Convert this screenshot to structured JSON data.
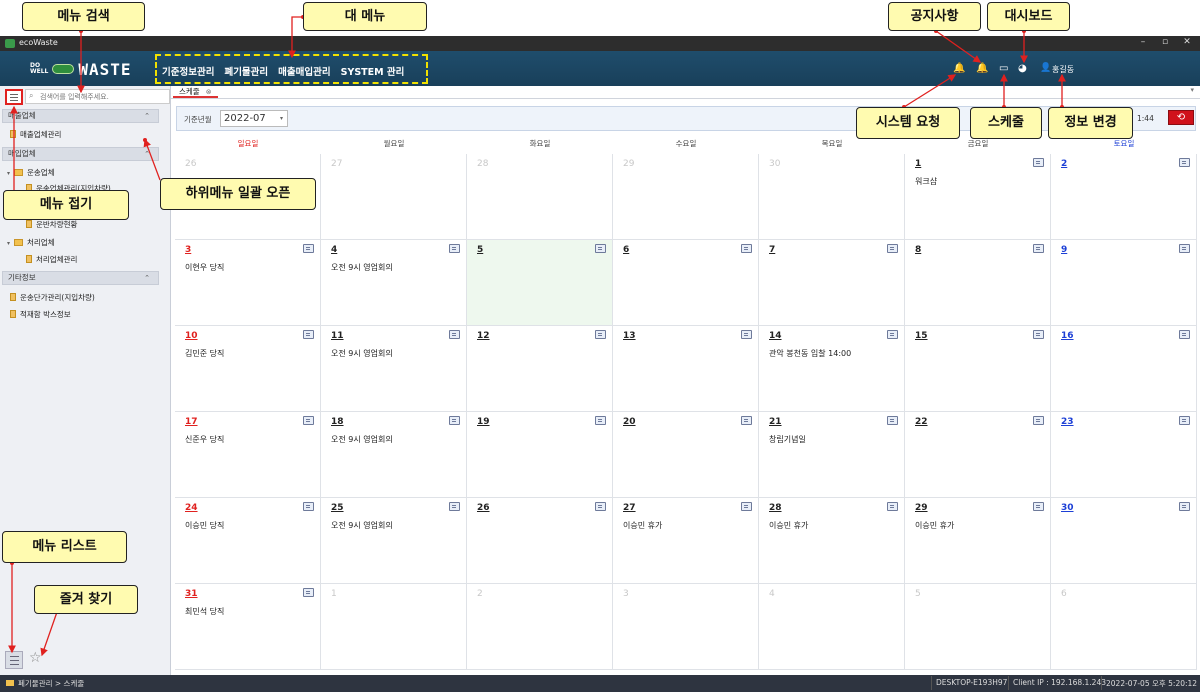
{
  "window": {
    "title": "ecoWaste",
    "buttons": [
      "–",
      "▫",
      "✕"
    ]
  },
  "header": {
    "logo_small": "DO\nWELL",
    "logo_text": "WASTE",
    "main_menu": [
      "기준정보관리",
      "폐기물관리",
      "매출매입관리",
      "SYSTEM 관리"
    ],
    "user_name": "홍길동"
  },
  "sidebar": {
    "search_placeholder": "검색어를 입력해주세요.",
    "sections": [
      {
        "title": "매출업체",
        "items": [
          {
            "label": "매출업체관리",
            "icon": "page-icon"
          }
        ]
      },
      {
        "title": "매입업체",
        "items": [
          {
            "label": "운송업체",
            "icon": "folder-icon"
          },
          {
            "label": "운송업체관리(지입차량)",
            "icon": "page-icon"
          },
          {
            "label": "운반차량현황",
            "icon": "page-icon"
          },
          {
            "label": "처리업체",
            "icon": "folder-icon"
          },
          {
            "label": "처리업체관리",
            "icon": "page-icon"
          }
        ]
      },
      {
        "title": "기타정보",
        "items": [
          {
            "label": "운송단가관리(지입차량)",
            "icon": "page-icon"
          },
          {
            "label": "적재함 박스정보",
            "icon": "page-icon"
          }
        ]
      }
    ]
  },
  "tab": {
    "label": "스케줄",
    "close": "⊗"
  },
  "filter": {
    "label": "기준년월",
    "month": "2022-07",
    "time": "1:44"
  },
  "calendar": {
    "weekdays": [
      "일요일",
      "월요일",
      "화요일",
      "수요일",
      "목요일",
      "금요일",
      "토요일"
    ],
    "weeks": [
      [
        {
          "day": "26",
          "other": true
        },
        {
          "day": "27",
          "other": true
        },
        {
          "day": "28",
          "other": true
        },
        {
          "day": "29",
          "other": true
        },
        {
          "day": "30",
          "other": true
        },
        {
          "day": "1",
          "event": "워크샵"
        },
        {
          "day": "2"
        }
      ],
      [
        {
          "day": "3",
          "event": "이현우 당직"
        },
        {
          "day": "4",
          "event": "오전 9시 영업회의"
        },
        {
          "day": "5",
          "today": true
        },
        {
          "day": "6"
        },
        {
          "day": "7"
        },
        {
          "day": "8"
        },
        {
          "day": "9"
        }
      ],
      [
        {
          "day": "10",
          "event": "김민준 당직"
        },
        {
          "day": "11",
          "event": "오전 9시 영업회의"
        },
        {
          "day": "12"
        },
        {
          "day": "13"
        },
        {
          "day": "14",
          "event": "관악 봉천동 입찰 14:00"
        },
        {
          "day": "15"
        },
        {
          "day": "16"
        }
      ],
      [
        {
          "day": "17",
          "event": "신준우 당직"
        },
        {
          "day": "18",
          "event": "오전 9시 영업회의"
        },
        {
          "day": "19"
        },
        {
          "day": "20"
        },
        {
          "day": "21",
          "event": "창립기념일"
        },
        {
          "day": "22"
        },
        {
          "day": "23"
        }
      ],
      [
        {
          "day": "24",
          "event": "이승민 당직"
        },
        {
          "day": "25",
          "event": "오전 9시 영업회의"
        },
        {
          "day": "26"
        },
        {
          "day": "27",
          "event": "이승민 휴가"
        },
        {
          "day": "28",
          "event": "이승민 휴가"
        },
        {
          "day": "29",
          "event": "이승민 휴가"
        },
        {
          "day": "30"
        }
      ],
      [
        {
          "day": "31",
          "event": "최민석 당직"
        },
        {
          "day": "1",
          "other": true
        },
        {
          "day": "2",
          "other": true
        },
        {
          "day": "3",
          "other": true
        },
        {
          "day": "4",
          "other": true
        },
        {
          "day": "5",
          "other": true
        },
        {
          "day": "6",
          "other": true
        }
      ]
    ]
  },
  "statusbar": {
    "breadcrumb": "폐기물관리 > 스케줄",
    "computer": "DESKTOP-E193H97",
    "client_ip": "Client IP : 192.168.1.243",
    "datetime": "2022-07-05 오후 5:20:12"
  },
  "annotations": {
    "menu_search": "메뉴 검색",
    "main_menu": "대 메뉴",
    "notice": "공지사항",
    "dashboard": "대시보드",
    "system_request": "시스템 요청",
    "schedule": "스케줄",
    "info_change": "정보 변경",
    "submenu_open_all": "하위메뉴 일괄 오픈",
    "menu_collapse": "메뉴 접기",
    "menu_list": "메뉴 리스트",
    "favorites": "즐겨 찾기"
  },
  "colors": {
    "header": "#1f4d6c",
    "sunday": "#e0211f",
    "saturday": "#1c3fd6",
    "callout": "#fffbb0",
    "accent_red": "#d0121b"
  }
}
